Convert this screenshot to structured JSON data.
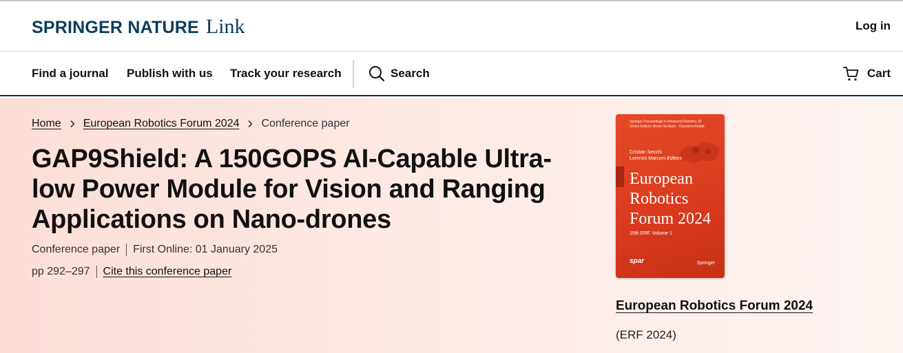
{
  "header": {
    "brand": "SPRINGER NATURE",
    "product": "Link",
    "login_label": "Log in"
  },
  "nav": {
    "items": [
      "Find a journal",
      "Publish with us",
      "Track your research"
    ],
    "search_label": "Search",
    "cart_label": "Cart"
  },
  "breadcrumb": {
    "items": [
      "Home",
      "European Robotics Forum 2024"
    ],
    "current": "Conference paper"
  },
  "article": {
    "title": "GAP9Shield: A 150GOPS AI-Capable Ultra-low Power Module for Vision and Ranging Applications on Nano-drones",
    "type": "Conference paper",
    "first_online": "First Online: 01 January 2025",
    "pages": "pp 292–297",
    "cite_label": "Cite this conference paper"
  },
  "book": {
    "cover": {
      "series_line1": "Springer Proceedings in Advanced Robotics 32",
      "series_line2": "Series Editors: Bruno Siciliano · Oussama Khatib",
      "editor1": "Cristian Secchi",
      "editor2": "Lorenzo Marconi",
      "editors_suffix": "Editors",
      "title_line1": "European",
      "title_line2": "Robotics",
      "title_line3": "Forum 2024",
      "subtitle": "15th ERF, Volume 1",
      "spar": "spar",
      "publisher": "Springer"
    },
    "title": "European Robotics Forum 2024",
    "abbr": "(ERF 2024)"
  },
  "colors": {
    "brand": "#0b3d5c",
    "cover": "#e0421f",
    "hero_bg": "#fde6e0"
  }
}
